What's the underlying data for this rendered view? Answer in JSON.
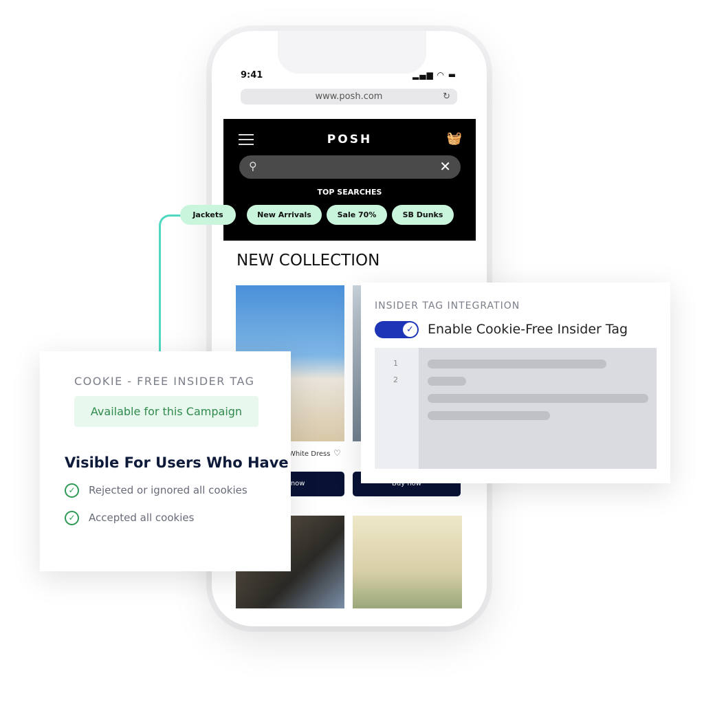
{
  "phone": {
    "time": "9:41",
    "status_icons": "signal wifi battery",
    "url": "www.posh.com",
    "reload_icon": "reload-icon"
  },
  "header": {
    "logo": "POSH",
    "top_searches_label": "TOP SEARCHES",
    "chips": [
      "Jackets",
      "New Arrivals",
      "Sale 70%",
      "SB Dunks"
    ]
  },
  "main": {
    "title": "NEW COLLECTION",
    "products": [
      {
        "name": "White Dress",
        "button": "Buy now"
      },
      {
        "name": "",
        "button": "Buy now"
      }
    ]
  },
  "cookie_card": {
    "title": "COOKIE - FREE INSIDER TAG",
    "badge": "Available for this Campaign",
    "heading": "Visible For Users Who Have",
    "items": [
      "Rejected or ignored all cookies",
      "Accepted all cookies"
    ],
    "accent": "#2f9a56"
  },
  "insider_card": {
    "title": "INSIDER TAG INTEGRATION",
    "toggle_label": "Enable Cookie-Free Insider Tag",
    "toggle_on": true,
    "line_numbers": [
      "1",
      "2"
    ],
    "accent": "#1f35b8"
  }
}
